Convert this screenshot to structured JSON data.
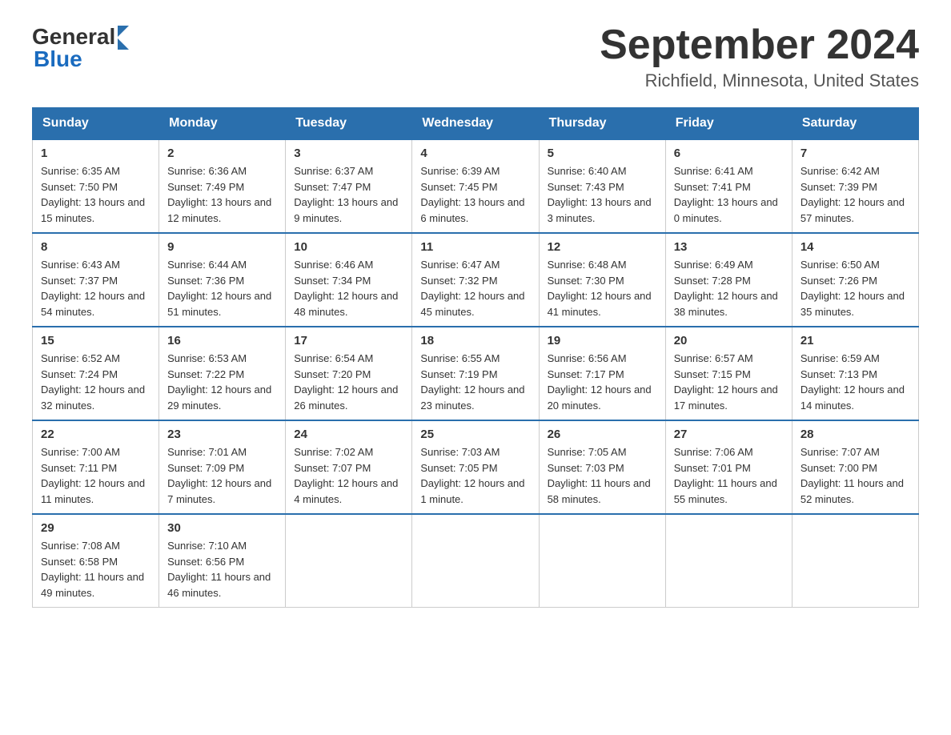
{
  "header": {
    "logo_general": "General",
    "logo_blue": "Blue",
    "month_title": "September 2024",
    "location": "Richfield, Minnesota, United States"
  },
  "days_of_week": [
    "Sunday",
    "Monday",
    "Tuesday",
    "Wednesday",
    "Thursday",
    "Friday",
    "Saturday"
  ],
  "weeks": [
    [
      {
        "day": "1",
        "sunrise": "6:35 AM",
        "sunset": "7:50 PM",
        "daylight": "13 hours and 15 minutes."
      },
      {
        "day": "2",
        "sunrise": "6:36 AM",
        "sunset": "7:49 PM",
        "daylight": "13 hours and 12 minutes."
      },
      {
        "day": "3",
        "sunrise": "6:37 AM",
        "sunset": "7:47 PM",
        "daylight": "13 hours and 9 minutes."
      },
      {
        "day": "4",
        "sunrise": "6:39 AM",
        "sunset": "7:45 PM",
        "daylight": "13 hours and 6 minutes."
      },
      {
        "day": "5",
        "sunrise": "6:40 AM",
        "sunset": "7:43 PM",
        "daylight": "13 hours and 3 minutes."
      },
      {
        "day": "6",
        "sunrise": "6:41 AM",
        "sunset": "7:41 PM",
        "daylight": "13 hours and 0 minutes."
      },
      {
        "day": "7",
        "sunrise": "6:42 AM",
        "sunset": "7:39 PM",
        "daylight": "12 hours and 57 minutes."
      }
    ],
    [
      {
        "day": "8",
        "sunrise": "6:43 AM",
        "sunset": "7:37 PM",
        "daylight": "12 hours and 54 minutes."
      },
      {
        "day": "9",
        "sunrise": "6:44 AM",
        "sunset": "7:36 PM",
        "daylight": "12 hours and 51 minutes."
      },
      {
        "day": "10",
        "sunrise": "6:46 AM",
        "sunset": "7:34 PM",
        "daylight": "12 hours and 48 minutes."
      },
      {
        "day": "11",
        "sunrise": "6:47 AM",
        "sunset": "7:32 PM",
        "daylight": "12 hours and 45 minutes."
      },
      {
        "day": "12",
        "sunrise": "6:48 AM",
        "sunset": "7:30 PM",
        "daylight": "12 hours and 41 minutes."
      },
      {
        "day": "13",
        "sunrise": "6:49 AM",
        "sunset": "7:28 PM",
        "daylight": "12 hours and 38 minutes."
      },
      {
        "day": "14",
        "sunrise": "6:50 AM",
        "sunset": "7:26 PM",
        "daylight": "12 hours and 35 minutes."
      }
    ],
    [
      {
        "day": "15",
        "sunrise": "6:52 AM",
        "sunset": "7:24 PM",
        "daylight": "12 hours and 32 minutes."
      },
      {
        "day": "16",
        "sunrise": "6:53 AM",
        "sunset": "7:22 PM",
        "daylight": "12 hours and 29 minutes."
      },
      {
        "day": "17",
        "sunrise": "6:54 AM",
        "sunset": "7:20 PM",
        "daylight": "12 hours and 26 minutes."
      },
      {
        "day": "18",
        "sunrise": "6:55 AM",
        "sunset": "7:19 PM",
        "daylight": "12 hours and 23 minutes."
      },
      {
        "day": "19",
        "sunrise": "6:56 AM",
        "sunset": "7:17 PM",
        "daylight": "12 hours and 20 minutes."
      },
      {
        "day": "20",
        "sunrise": "6:57 AM",
        "sunset": "7:15 PM",
        "daylight": "12 hours and 17 minutes."
      },
      {
        "day": "21",
        "sunrise": "6:59 AM",
        "sunset": "7:13 PM",
        "daylight": "12 hours and 14 minutes."
      }
    ],
    [
      {
        "day": "22",
        "sunrise": "7:00 AM",
        "sunset": "7:11 PM",
        "daylight": "12 hours and 11 minutes."
      },
      {
        "day": "23",
        "sunrise": "7:01 AM",
        "sunset": "7:09 PM",
        "daylight": "12 hours and 7 minutes."
      },
      {
        "day": "24",
        "sunrise": "7:02 AM",
        "sunset": "7:07 PM",
        "daylight": "12 hours and 4 minutes."
      },
      {
        "day": "25",
        "sunrise": "7:03 AM",
        "sunset": "7:05 PM",
        "daylight": "12 hours and 1 minute."
      },
      {
        "day": "26",
        "sunrise": "7:05 AM",
        "sunset": "7:03 PM",
        "daylight": "11 hours and 58 minutes."
      },
      {
        "day": "27",
        "sunrise": "7:06 AM",
        "sunset": "7:01 PM",
        "daylight": "11 hours and 55 minutes."
      },
      {
        "day": "28",
        "sunrise": "7:07 AM",
        "sunset": "7:00 PM",
        "daylight": "11 hours and 52 minutes."
      }
    ],
    [
      {
        "day": "29",
        "sunrise": "7:08 AM",
        "sunset": "6:58 PM",
        "daylight": "11 hours and 49 minutes."
      },
      {
        "day": "30",
        "sunrise": "7:10 AM",
        "sunset": "6:56 PM",
        "daylight": "11 hours and 46 minutes."
      },
      null,
      null,
      null,
      null,
      null
    ]
  ]
}
